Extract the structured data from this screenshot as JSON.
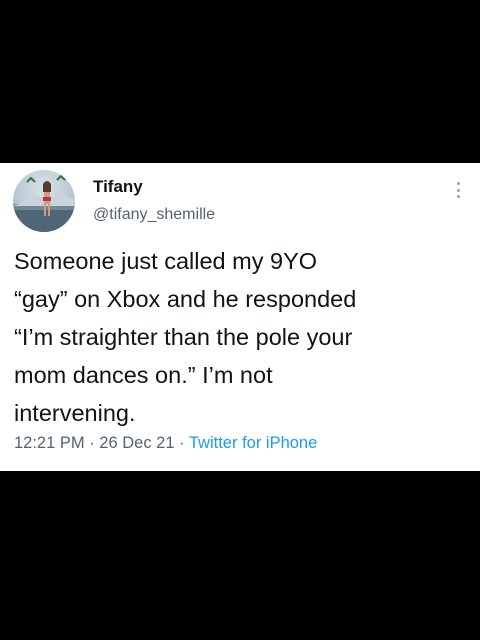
{
  "tweet": {
    "display_name": "Tifany",
    "handle": "@tifany_shemille",
    "text_lines": [
      "Someone just called my 9YO",
      "“gay” on Xbox and he responded",
      "“I’m straighter than the pole your",
      "mom dances on.” I’m not",
      "intervening."
    ],
    "time": "12:21 PM",
    "separator_1": " · ",
    "date": "26 Dec 21",
    "separator_2": " · ",
    "source": "Twitter for iPhone",
    "more_icon": "more-vertical-icon",
    "colors": {
      "text": "#0f1419",
      "secondary": "#536471",
      "link": "#1d9bf0",
      "background": "#ffffff",
      "frame": "#000000"
    }
  }
}
